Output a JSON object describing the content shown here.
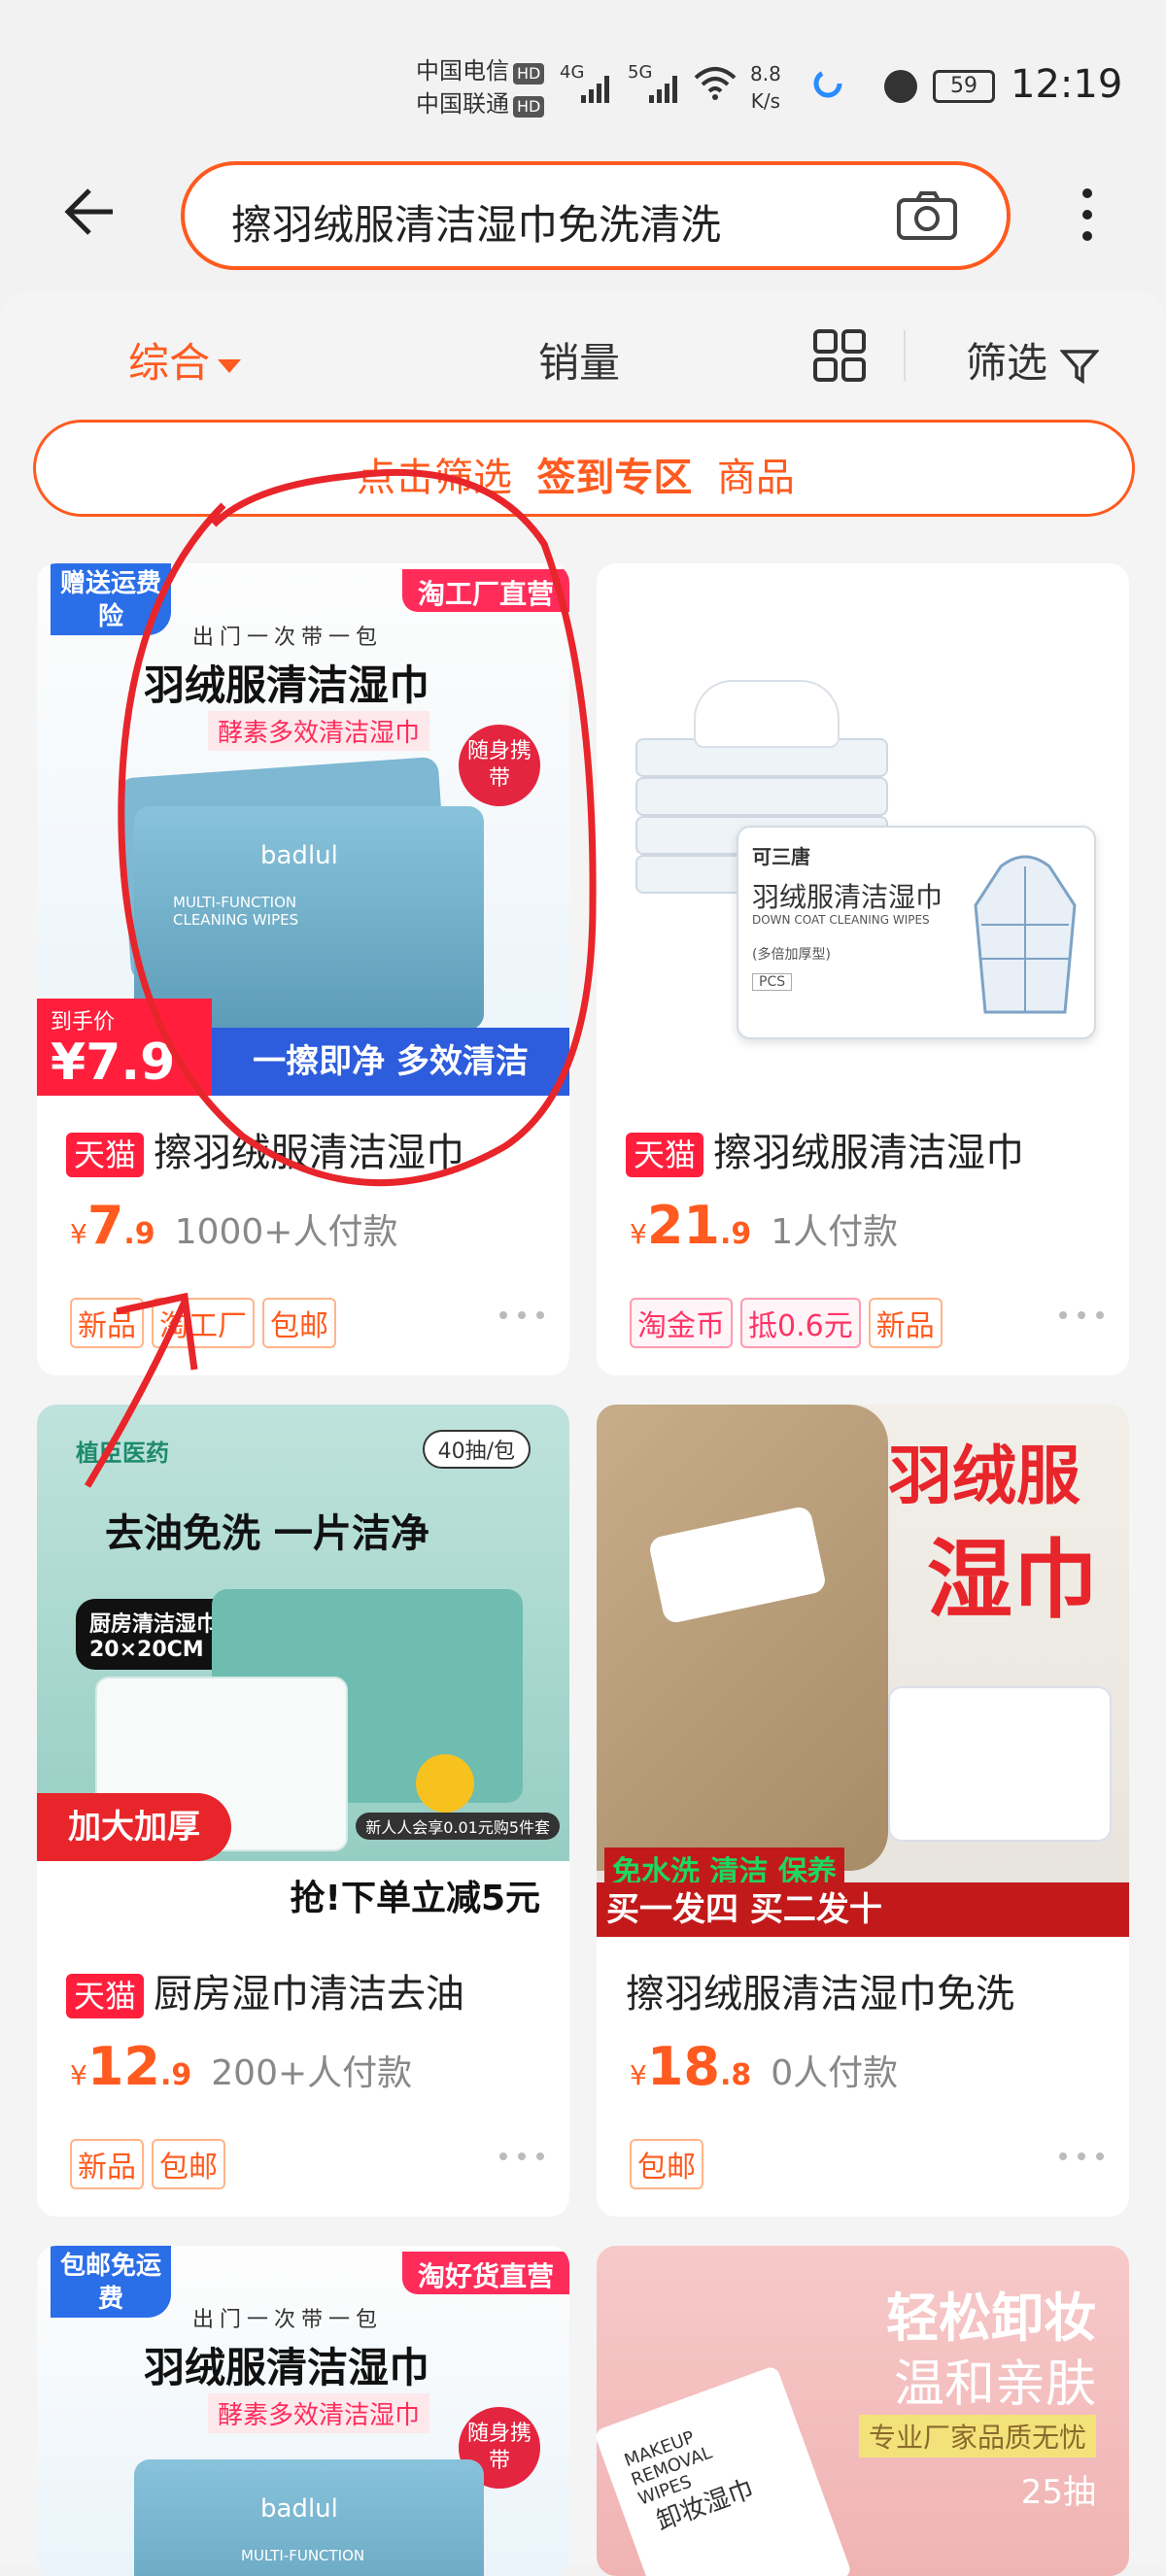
{
  "status": {
    "carrier1": "中国电信",
    "carrier2": "中国联通",
    "hd": "HD",
    "net1": "4G",
    "net2": "5G",
    "wifi": "6",
    "speed_value": "8.8",
    "speed_unit": "K/s",
    "battery": "59",
    "time": "12:19"
  },
  "search": {
    "query": "擦羽绒服清洁湿巾免洗清洗"
  },
  "sort": {
    "comprehensive": "综合",
    "sales": "销量",
    "filter": "筛选"
  },
  "filter_row": {
    "hint": "点击筛选",
    "signin": "签到专区",
    "goods": "商品"
  },
  "products": [
    {
      "badge_tl": "赠送运费险",
      "badge_tr": "淘工厂直营",
      "headline_small": "出门一次带一包",
      "headline": "羽绒服清洁湿巾",
      "sub": "酵素多效清洁湿巾",
      "bubble": "随身携带",
      "pack_brand": "badlul",
      "pack_text": "MULTI-FUNCTION CLEANING WIPES",
      "deal_label": "到手价",
      "deal_price": "¥7.9",
      "bottom_slogan": "一擦即净 多效清洁",
      "tmall": "天猫",
      "title": "擦羽绒服清洁湿巾",
      "yen": "¥",
      "price_int": "7",
      "price_dec": ".9",
      "sold": "1000+人付款",
      "tags": [
        "新品",
        "淘工厂",
        "包邮"
      ]
    },
    {
      "pack_brand": "可三唐",
      "pack_title": "羽绒服清洁湿巾",
      "pack_en": "DOWN COAT CLEANING WIPES",
      "pack_note": "(多倍加厚型)",
      "pack_count": "PCS",
      "tmall": "天猫",
      "title": "擦羽绒服清洁湿巾",
      "yen": "¥",
      "price_int": "21",
      "price_dec": ".9",
      "sold": "1人付款",
      "tags": [
        "淘金币",
        "抵0.6元",
        "新品"
      ]
    },
    {
      "brand": "植臣医药",
      "count": "40抽/包",
      "headline": "去油免洗 一片洁净",
      "size_label": "厨房清洁湿巾 20×20CM",
      "left_banner": "加大加厚",
      "promo_small": "新人人会享0.01元购5件套",
      "bottom_slogan": "抢!下单立减5元",
      "tmall": "天猫",
      "title": "厨房湿巾清洁去油",
      "yen": "¥",
      "price_int": "12",
      "price_dec": ".9",
      "sold": "200+人付款",
      "tags": [
        "新品",
        "包邮"
      ]
    },
    {
      "headline1": "羽绒服",
      "headline2": "湿巾",
      "green_text": "免水洗 清洁 保养",
      "bottom_slogan": "买一发四 买二发十",
      "title": "擦羽绒服清洁湿巾免洗",
      "yen": "¥",
      "price_int": "18",
      "price_dec": ".8",
      "sold": "0人付款",
      "tags": [
        "包邮"
      ]
    },
    {
      "badge_tl": "包邮免运费",
      "badge_tr": "淘好货直营",
      "headline_small": "出门一次带一包",
      "headline": "羽绒服清洁湿巾",
      "sub": "酵素多效清洁湿巾",
      "bubble": "随身携带",
      "pack_brand": "badlul",
      "pack_text": "MULTI-FUNCTION"
    },
    {
      "headline1": "轻松卸妆",
      "headline2": "温和亲肤",
      "sub": "专业厂家品质无忧",
      "count": "25抽",
      "pack_text": "MAKEUP REMOVAL WIPES",
      "pack_cn": "卸妆湿巾"
    }
  ],
  "colors": {
    "accent": "#ff5a1f",
    "tmall": "#ff1f3d",
    "annotation": "#e8252a"
  }
}
